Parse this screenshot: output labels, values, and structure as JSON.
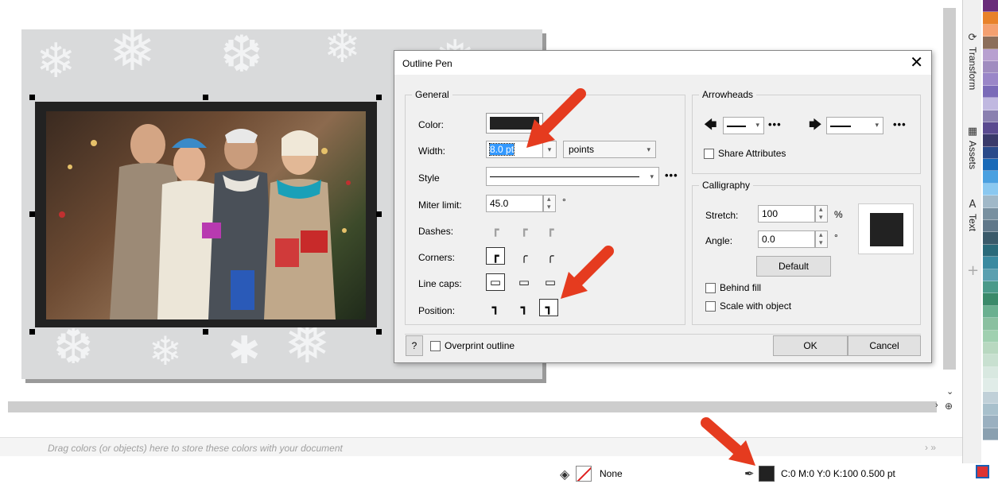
{
  "dialog": {
    "title": "Outline Pen",
    "general": {
      "title": "General",
      "color_label": "Color:",
      "width_label": "Width:",
      "width_value": "8.0 pt",
      "units_value": "points",
      "style_label": "Style",
      "miter_label": "Miter limit:",
      "miter_value": "45.0",
      "miter_unit": "°",
      "dashes_label": "Dashes:",
      "corners_label": "Corners:",
      "line_caps_label": "Line caps:",
      "position_label": "Position:"
    },
    "arrowheads": {
      "title": "Arrowheads",
      "share_attributes": "Share Attributes"
    },
    "calligraphy": {
      "title": "Calligraphy",
      "stretch_label": "Stretch:",
      "stretch_value": "100",
      "stretch_unit": "%",
      "angle_label": "Angle:",
      "angle_value": "0.0",
      "angle_unit": "°",
      "default_button": "Default",
      "behind_fill": "Behind fill",
      "scale_with_object": "Scale with object"
    },
    "help_button": "?",
    "overprint_outline": "Overprint outline",
    "ok_button": "OK",
    "cancel_button": "Cancel",
    "more_glyph": "•••"
  },
  "dockers": {
    "transform": "Transform",
    "assets": "Assets",
    "text": "Text"
  },
  "document_palette": {
    "hint": "Drag colors (or objects) here to store these colors with your document"
  },
  "status_bar": {
    "fill_label": "None",
    "outline_label": "C:0 M:0 Y:0 K:100  0.500 pt"
  },
  "palette_colors": [
    "#6a2c7a",
    "#e8822a",
    "#f4a070",
    "#8c6e5a",
    "#b8a0d0",
    "#a08cc0",
    "#9a86c8",
    "#7a6ab8",
    "#c0b8e0",
    "#8a80b0",
    "#5a4a90",
    "#3a3a6a",
    "#2a4a8a",
    "#1a6ab8",
    "#4aa0e0",
    "#8ac8f0",
    "#a0b8c8",
    "#7890a0",
    "#60788a",
    "#3a5a6a",
    "#2a6a7a",
    "#3a8aa0",
    "#5aa0b0",
    "#4a9a8a",
    "#3a8a6a",
    "#6ab090",
    "#8ac0a0",
    "#a0d0b0",
    "#b8d8c0",
    "#c8e0d0",
    "#d8e8e0",
    "#e0ece8",
    "#c0d0d8",
    "#a8c0cc",
    "#9ab0c0",
    "#8aa0b0"
  ],
  "colors": {
    "outline": "#222222",
    "annotation": "#e53b1f",
    "selection": "#3399ff"
  }
}
